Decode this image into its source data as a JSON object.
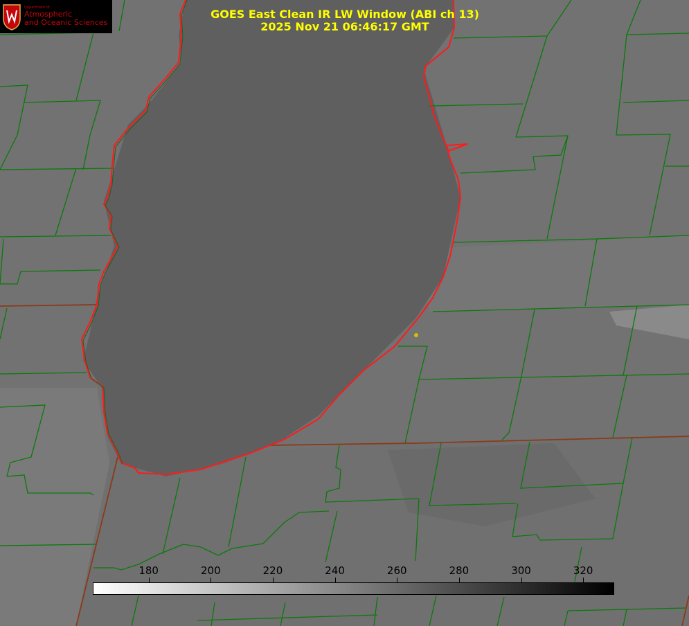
{
  "title": {
    "line1": "GOES East Clean IR LW Window (ABI ch 13)",
    "line2": "2025 Nov 21 06:46:17 GMT"
  },
  "logo": {
    "dept": "Department of",
    "line1": "Atmospheric",
    "line2": "and Oceanic Sciences",
    "brand_color": "#c5050c"
  },
  "colorbar": {
    "min": 162,
    "max": 330,
    "gradient_start": "#ffffff",
    "gradient_end": "#000000",
    "ticks": [
      {
        "value": 180,
        "label": "180"
      },
      {
        "value": 200,
        "label": "200"
      },
      {
        "value": 220,
        "label": "220"
      },
      {
        "value": 240,
        "label": "240"
      },
      {
        "value": 260,
        "label": "260"
      },
      {
        "value": 280,
        "label": "280"
      },
      {
        "value": 300,
        "label": "300"
      },
      {
        "value": 320,
        "label": "320"
      }
    ]
  },
  "colors": {
    "title": "#ffff00",
    "county_lines": "#0a7a0a",
    "state_lines": "#8a3a1a",
    "lake_outline": "#ff1a1a",
    "marker": "#d4c000",
    "lake_fill": "#5c5c5c",
    "land_fill": "#6e6e6e"
  }
}
